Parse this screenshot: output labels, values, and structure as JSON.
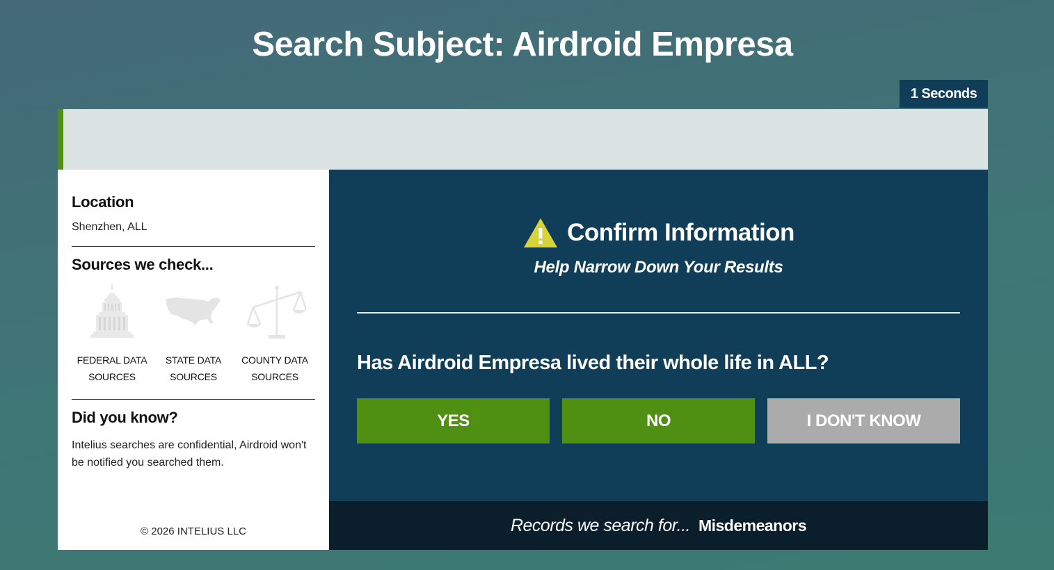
{
  "header": {
    "title_prefix": "Search Subject:",
    "subject_name": "Airdroid Empresa"
  },
  "timer": {
    "label": "1 Seconds"
  },
  "progress": {
    "percent": 0.6,
    "color": "#4f9012"
  },
  "sidebar": {
    "location_heading": "Location",
    "location_value": "Shenzhen, ALL",
    "sources_heading": "Sources we check...",
    "sources": [
      {
        "icon": "capitol-building-icon",
        "line1": "FEDERAL DATA",
        "line2": "SOURCES"
      },
      {
        "icon": "usa-map-icon",
        "line1": "STATE DATA",
        "line2": "SOURCES"
      },
      {
        "icon": "scales-of-justice-icon",
        "line1": "COUNTY DATA",
        "line2": "SOURCES"
      }
    ],
    "did_you_know_heading": "Did you know?",
    "did_you_know_text": "Intelius searches are confidential, Airdroid won't be notified you searched them.",
    "copyright": "© 2026 INTELIUS LLC"
  },
  "panel": {
    "icon": "warning-icon",
    "title": "Confirm Information",
    "subtitle": "Help Narrow Down Your Results",
    "question": "Has Airdroid Empresa lived their whole life in ALL?",
    "answers": {
      "yes": "YES",
      "no": "NO",
      "dont_know": "I DON'T KNOW"
    }
  },
  "records": {
    "label": "Records we search for...",
    "value": "Misdemeanors"
  },
  "colors": {
    "panel_bg": "#103e58",
    "accent_green": "#4f9012",
    "button_gray": "#ababab",
    "warning_yellow": "#d7d43a",
    "footer_bar": "#0a1e2b"
  }
}
